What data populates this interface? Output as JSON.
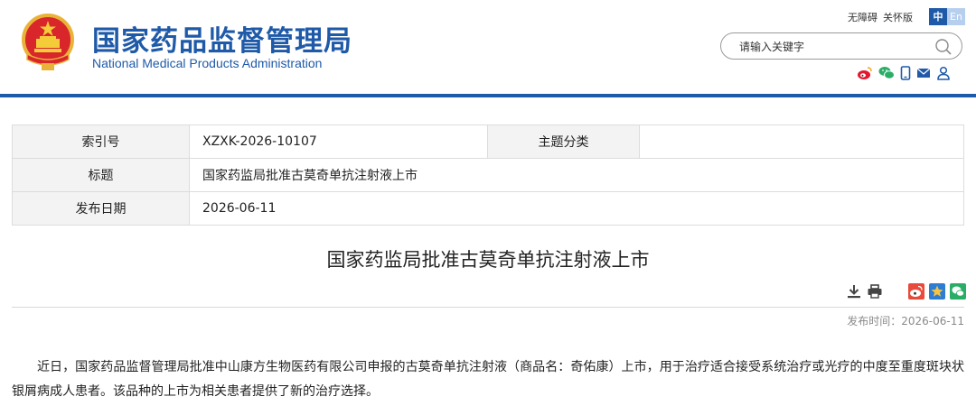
{
  "header": {
    "title_cn": "国家药品监督管理局",
    "title_en": "National Medical Products Administration",
    "accessibility_link": "无障碍",
    "care_mode_link": "关怀版",
    "lang_zh": "中",
    "lang_en": "En",
    "search_placeholder": "请输入关键字",
    "brand_color": "#1f5aa8",
    "social_icons": [
      "weibo-icon",
      "wechat-icon",
      "mobile-icon",
      "mail-icon",
      "user-icon"
    ]
  },
  "info_table": {
    "index_label": "索引号",
    "index_value": "XZXK-2026-10107",
    "category_label": "主题分类",
    "category_value": "",
    "title_label": "标题",
    "title_value": "国家药监局批准古莫奇单抗注射液上市",
    "date_label": "发布日期",
    "date_value": "2026-06-11"
  },
  "article": {
    "title": "国家药监局批准古莫奇单抗注射液上市",
    "publish_time": "发布时间：2026-06-11",
    "tool_icons": [
      "download-icon",
      "print-icon",
      "share-weibo-icon",
      "favorite-icon",
      "share-wechat-icon"
    ],
    "body": "近日，国家药品监督管理局批准中山康方生物医药有限公司申报的古莫奇单抗注射液（商品名：奇佑康）上市，用于治疗适合接受系统治疗或光疗的中度至重度斑块状银屑病成人患者。该品种的上市为相关患者提供了新的治疗选择。"
  }
}
